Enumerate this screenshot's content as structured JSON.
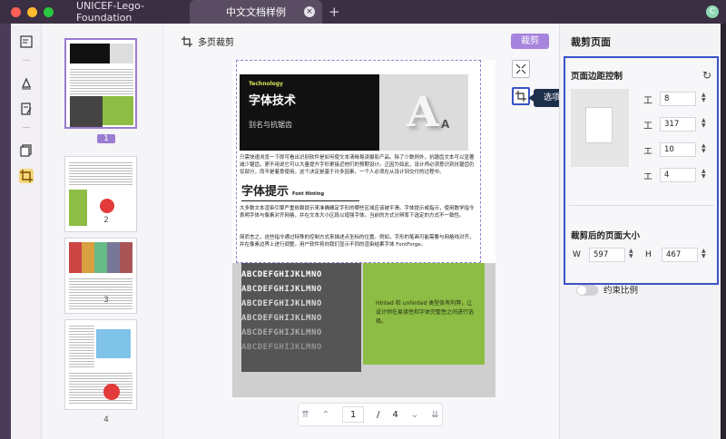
{
  "window": {
    "tabs": [
      {
        "label": "UNICEF-Lego-Foundation"
      },
      {
        "label": "中文文档样例"
      }
    ],
    "add_tab_symbol": "+",
    "close_symbol": "×",
    "avatar_initial": "C"
  },
  "thumbnails": {
    "pages": [
      "1",
      "2",
      "3",
      "4"
    ],
    "selected": "1"
  },
  "toolbar": {
    "multi_crop_label": "多页裁剪",
    "crop_button_label": "裁剪"
  },
  "tooltip": {
    "label": "选项"
  },
  "page": {
    "tag": "Technology",
    "title": "字体技术",
    "subtitle": "别名与抗锯齿",
    "intro": "只需快速浏览一下即可看出识别软件是如何使文本清晰易读摄影产品。除了少数例外，抗锯齿文本可以显著减少锯齿，更不用说它可以大量提升字形更接近他们的预期设计。正因为如此，设计师必须意识到抗锯齿仍仅部分，而不是着意使用。这个决定是基于许多因素，一个人必须在从设计到交付的过程中。",
    "h2": "字体提示",
    "h2_en": "Font Hinting",
    "body1": "大多数文本渲染引擎严重依赖提示来准确确定字形的哪些区域应该被平滑。字体提示或指示，使用数学指令表明字体与像素对齐网格，并在文本大小区段以增强字体。当前的方式分辨率下选定的方式不一致性。",
    "body2": "简而言之，这些指令通过特殊的控制方式来描述点坐标的位置。例如，字形的笔画可能需要与网格线对齐，并在像素边界上进行调整。用户软件将向我们显示不同的渲染结果字体 FontForge。",
    "sample_letters": "ABCDEFGHIJKLMNO",
    "green_text": "Hinted 和 unhinted 类型各有利弊，让设计师在易读性和字体完整性之间进行选择。"
  },
  "pager": {
    "current": "1",
    "separator": "/",
    "total": "4"
  },
  "right_panel": {
    "title": "裁剪页面",
    "margin_heading": "页面边距控制",
    "margins": [
      {
        "icon": "top-margin-icon",
        "value": "8"
      },
      {
        "icon": "bottom-margin-icon",
        "value": "317"
      },
      {
        "icon": "left-margin-icon",
        "value": "10"
      },
      {
        "icon": "right-margin-icon",
        "value": "4"
      }
    ],
    "size_heading": "裁剪后的页面大小",
    "width_label": "W",
    "width_value": "597",
    "height_label": "H",
    "height_value": "467",
    "constrain_label": "约束比例"
  },
  "colors": {
    "accent": "#a784dd",
    "highlight_border": "#3953c7",
    "green": "#8dbd44",
    "tooltip_bg": "#1d2f4b"
  }
}
